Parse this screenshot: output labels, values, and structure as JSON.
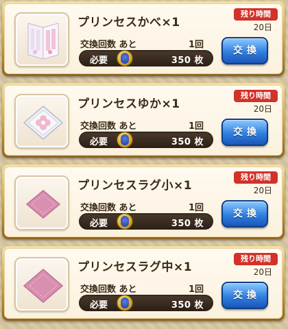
{
  "items": [
    {
      "title": "プリンセスかべ×1",
      "icon": "wall-icon",
      "time_limit_label": "残り時間",
      "time_limit_value": "20日",
      "exchange_count_label": "交換回数 あと",
      "exchange_count_value": "1回",
      "cost_label": "必要",
      "cost_value": "350 枚",
      "button_label": "交換"
    },
    {
      "title": "プリンセスゆか×1",
      "icon": "floor-icon",
      "time_limit_label": "残り時間",
      "time_limit_value": "20日",
      "exchange_count_label": "交換回数 あと",
      "exchange_count_value": "1回",
      "cost_label": "必要",
      "cost_value": "350 枚",
      "button_label": "交換"
    },
    {
      "title": "プリンセスラグ小×1",
      "icon": "rug-small-icon",
      "time_limit_label": "残り時間",
      "time_limit_value": "20日",
      "exchange_count_label": "交換回数 あと",
      "exchange_count_value": "1回",
      "cost_label": "必要",
      "cost_value": "350 枚",
      "button_label": "交換"
    },
    {
      "title": "プリンセスラグ中×1",
      "icon": "rug-medium-icon",
      "time_limit_label": "残り時間",
      "time_limit_value": "20日",
      "exchange_count_label": "交換回数 あと",
      "exchange_count_value": "1回",
      "cost_label": "必要",
      "cost_value": "350 枚",
      "button_label": "交換"
    }
  ],
  "colors": {
    "badge_red": "#d2322a",
    "button_blue": "#2f7fe0",
    "frame_gold": "#c99a3c",
    "rug_pink": "#d98fb0"
  }
}
